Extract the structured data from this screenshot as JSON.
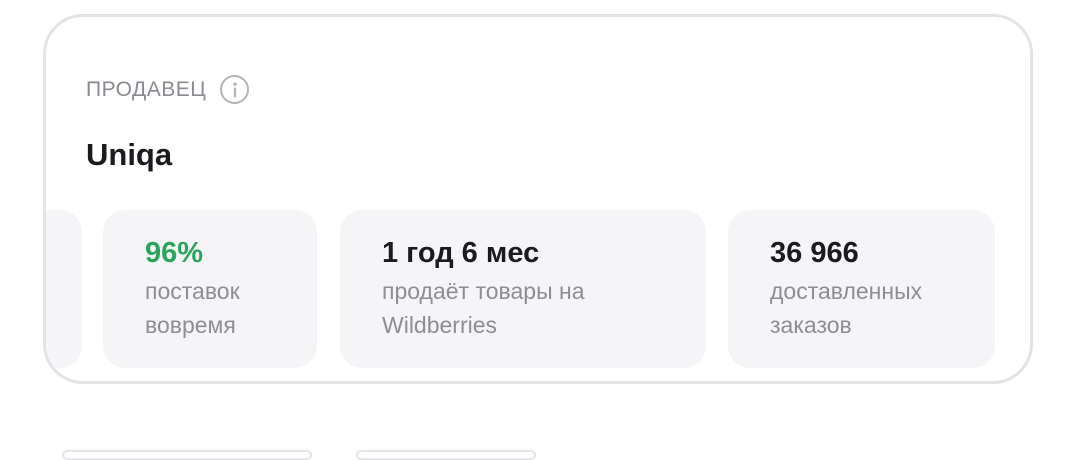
{
  "seller": {
    "label": "ПРОДАВЕЦ",
    "info_icon": "info-circle-icon",
    "name": "Uniqa"
  },
  "stats": [
    {
      "value": "96%",
      "description": "поставок\nвовремя",
      "value_color": "#2aa55e"
    },
    {
      "value": "1 год 6 мес",
      "description": "продаёт товары на\nWildberries"
    },
    {
      "value": "36 966",
      "description": "доставленных\nзаказов"
    }
  ],
  "colors": {
    "accent_green": "#2aa55e",
    "card_border": "#e3e3e6",
    "stat_bg": "#f5f5f7",
    "muted_text": "#8d8d94"
  }
}
